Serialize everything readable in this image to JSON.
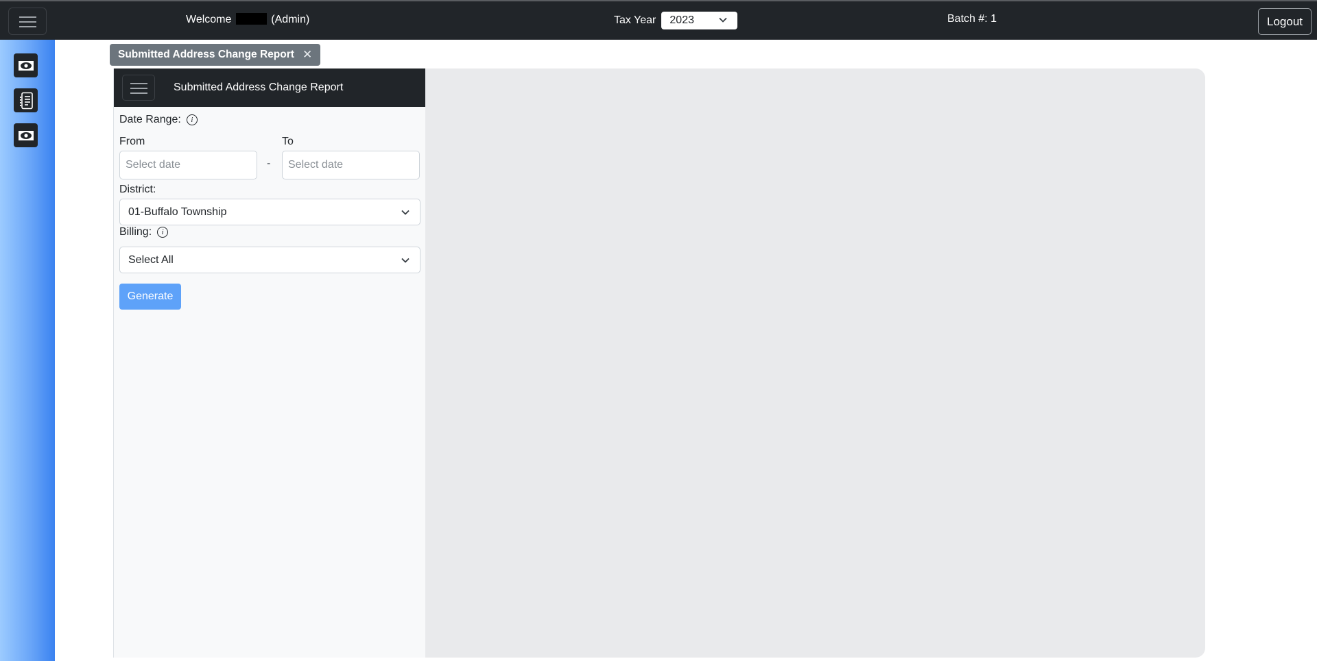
{
  "navbar": {
    "menu_icon": "hamburger-icon",
    "welcome_prefix": "Welcome",
    "welcome_role": "(Admin)",
    "tax_year_label": "Tax Year",
    "tax_year_value": "2023",
    "batch_label": "Batch #: 1",
    "logout_label": "Logout"
  },
  "siderail": {
    "items": [
      {
        "icon": "cash-icon"
      },
      {
        "icon": "list-document-icon"
      },
      {
        "icon": "cash-icon"
      }
    ]
  },
  "tab": {
    "label": "Submitted Address Change Report",
    "close_icon": "close-icon"
  },
  "panel": {
    "title": "Submitted Address Change Report",
    "date_range_label": "Date Range:",
    "from_label": "From",
    "to_label": "To",
    "from_placeholder": "Select date",
    "to_placeholder": "Select date",
    "separator": "-",
    "district_label": "District:",
    "district_value": "01-Buffalo Township",
    "billing_label": "Billing:",
    "billing_value": "Select All",
    "generate_label": "Generate"
  },
  "colors": {
    "navbar_bg": "#212529",
    "rail_gradient_start": "#9ccbff",
    "rail_gradient_end": "#3a82f0",
    "tab_bg": "#6c757d",
    "generate_bg": "#5ea2f9",
    "viewer_bg": "#e9eaec",
    "panel_bg": "#f8f9fa"
  }
}
